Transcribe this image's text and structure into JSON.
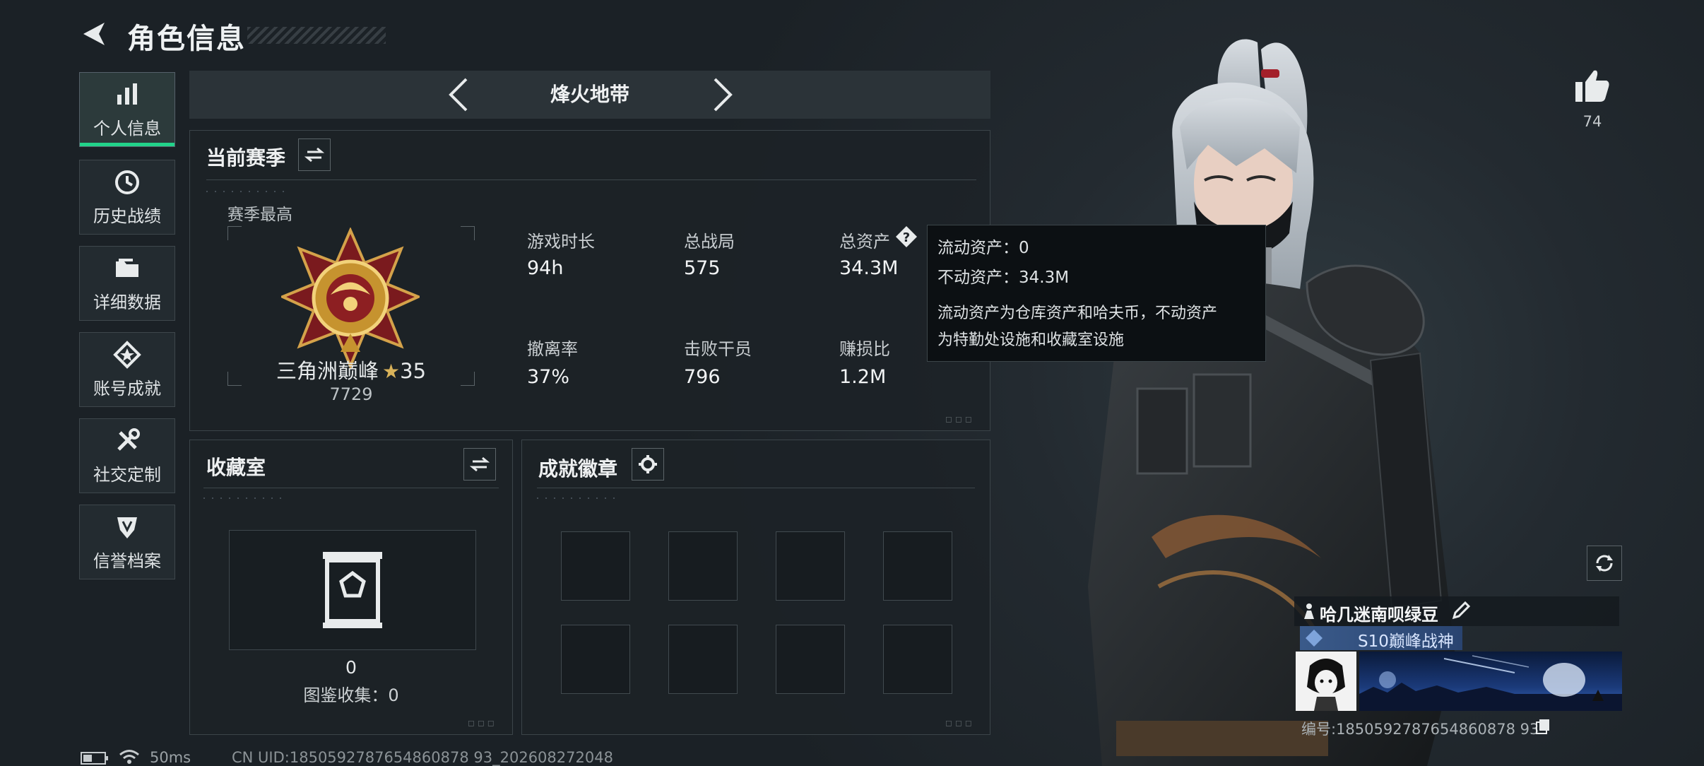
{
  "header": {
    "title": "角色信息"
  },
  "sidebar": {
    "items": [
      {
        "label": "个人信息",
        "icon": "bar-chart-icon",
        "active": true
      },
      {
        "label": "历史战绩",
        "icon": "clock-history-icon"
      },
      {
        "label": "详细数据",
        "icon": "folder-icon"
      },
      {
        "label": "账号成就",
        "icon": "achievement-star-icon"
      },
      {
        "label": "社交定制",
        "icon": "tools-icon"
      },
      {
        "label": "信誉档案",
        "icon": "shield-badge-icon"
      }
    ]
  },
  "mode": {
    "title": "烽火地带"
  },
  "season": {
    "heading": "当前赛季",
    "peak_label": "赛季最高",
    "rank_name": "三角洲巅峰",
    "rank_stars": "35",
    "rank_points": "7729",
    "stats": [
      {
        "label": "游戏时长",
        "value": "94h"
      },
      {
        "label": "总战局",
        "value": "575"
      },
      {
        "label": "总资产",
        "value": "34.3M"
      },
      {
        "label": "撤离率",
        "value": "37%"
      },
      {
        "label": "击败干员",
        "value": "796"
      },
      {
        "label": "赚损比",
        "value": "1.2M"
      }
    ]
  },
  "tooltip": {
    "line1": "流动资产：0",
    "line2": "不动资产：34.3M",
    "desc1": "流动资产为仓库资产和哈夫币，不动资产",
    "desc2": "为特勤处设施和收藏室设施"
  },
  "collection": {
    "heading": "收藏室",
    "count": "0",
    "catalog_label": "图鉴收集：0"
  },
  "badges": {
    "heading": "成就徽章"
  },
  "likes": {
    "count": "74"
  },
  "player": {
    "name": "哈几迷南呗绿豆",
    "title_tag": "S10巅峰战神",
    "id_label": "编号:1850592787654860878 93"
  },
  "status_bar": {
    "ping": "50ms",
    "uid": "CN UID:1850592787654860878 93_202608272048"
  },
  "colors": {
    "accent_green": "#22d38a",
    "panel_bg": "#1c2227",
    "tooltip_bg": "#0c1013"
  }
}
